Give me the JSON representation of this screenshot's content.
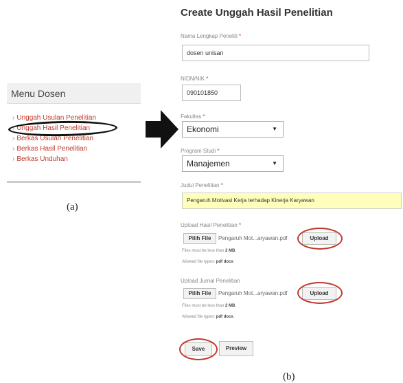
{
  "panel_a": {
    "menu_title": "Menu Dosen",
    "items": [
      {
        "label": "Unggah Usulan Penelitian"
      },
      {
        "label": "Unggah Hasil Penelitian"
      },
      {
        "label": "Berkas Usulan Penelitian"
      },
      {
        "label": "Berkas Hasil Penelitian"
      },
      {
        "label": "Berkas Unduhan"
      }
    ],
    "caption": "(a)"
  },
  "panel_b": {
    "title": "Create Unggah Hasil Penelitian",
    "required_mark": "*",
    "nama": {
      "label": "Nama Lengkap Peneliti",
      "value": "dosen unisan"
    },
    "nidn": {
      "label": "NIDN/NIK",
      "value": "090101850"
    },
    "fakultas": {
      "label": "Fakultas",
      "value": "Ekonomi"
    },
    "prodi": {
      "label": "Program Studi",
      "value": "Manajemen"
    },
    "judul": {
      "label": "Judul Penelitian",
      "value": "Pengaruh Motivasi Kerja terhadap Kinerja Karyawan"
    },
    "upload_hasil": {
      "label": "Upload Hasil Penelitian",
      "choose_label": "Pilih File",
      "filename": "Pengaruh Mot...aryawan.pdf",
      "upload_label": "Upload",
      "note_size_prefix": "Files must be less than",
      "note_size_value": "2 MB",
      "note_types_prefix": "Allowed file types:",
      "note_types_value": "pdf docx"
    },
    "upload_jurnal": {
      "label": "Upload Jurnal Penelitian",
      "choose_label": "Pilih File",
      "filename": "Pengaruh Mot...aryawan.pdf",
      "upload_label": "Upload",
      "note_size_prefix": "Files must be less than",
      "note_size_value": "2 MB",
      "note_types_prefix": "Allowed file types:",
      "note_types_value": "pdf docx"
    },
    "save_label": "Save",
    "preview_label": "Preview",
    "caption": "(b)",
    "highlight_color": "#c0392b",
    "judul_bg_color": "#ffffbb"
  }
}
